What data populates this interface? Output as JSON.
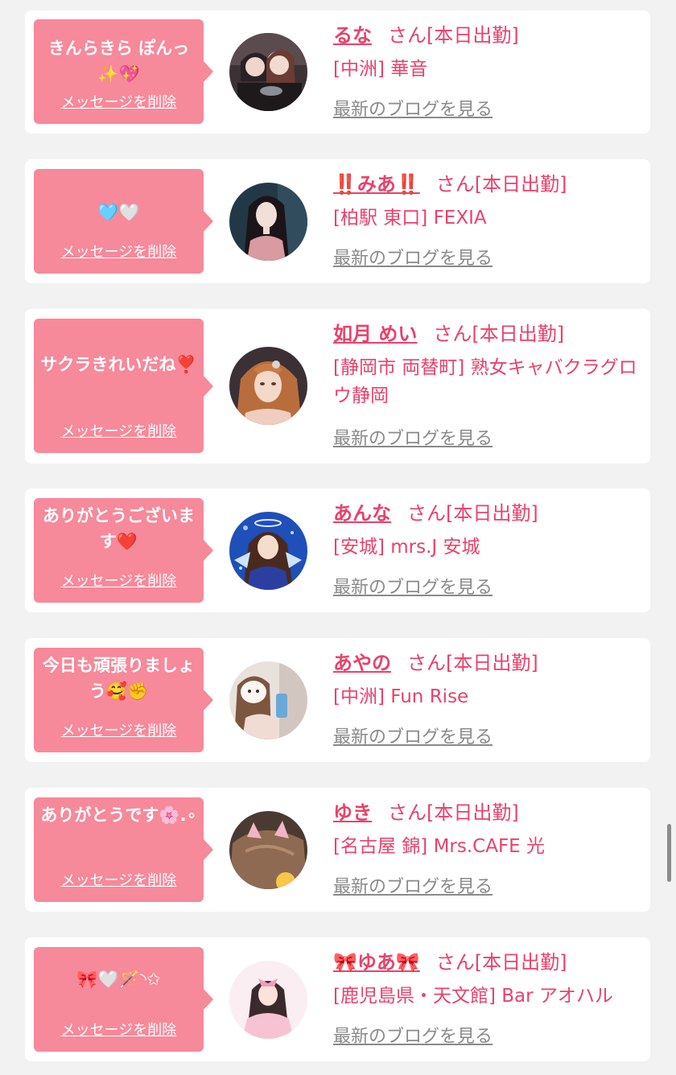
{
  "delete_label": "メッセージを削除",
  "name_suffix": "さん[本日出勤]",
  "blog_label": "最新のブログを見る",
  "colors": {
    "bubble": "#f6899a",
    "name": "#e8426b",
    "blog_link": "#8a8a8a",
    "page_bg": "#f2f2f2"
  },
  "items": [
    {
      "message": "きんらきら ぽんっ\n✨💖",
      "cast_name": "るな",
      "shop": "[中洲] 華音"
    },
    {
      "message": "🩵🤍",
      "cast_name": "‼️みあ‼️",
      "shop": "[柏駅 東口] FEXIA"
    },
    {
      "message": "サクラきれいだね❣️",
      "cast_name": "如月 めい",
      "shop": "[静岡市 両替町] 熟女キャバクラグロウ静岡"
    },
    {
      "message": "ありがとうございます❤️",
      "cast_name": "あんな",
      "shop": "[安城] mrs.J 安城"
    },
    {
      "message": "今日も頑張りましょう🥰✊",
      "cast_name": "あやの",
      "shop": "[中洲] Fun Rise"
    },
    {
      "message": "ありがとうです🌸.∘",
      "cast_name": "ゆき",
      "shop": "[名古屋 錦] Mrs.CAFE 光"
    },
    {
      "message": "🎀🤍🪄◝✩",
      "cast_name": "🎀ゆあ🎀",
      "shop": "[鹿児島県・天文館] Bar アオハル"
    }
  ]
}
